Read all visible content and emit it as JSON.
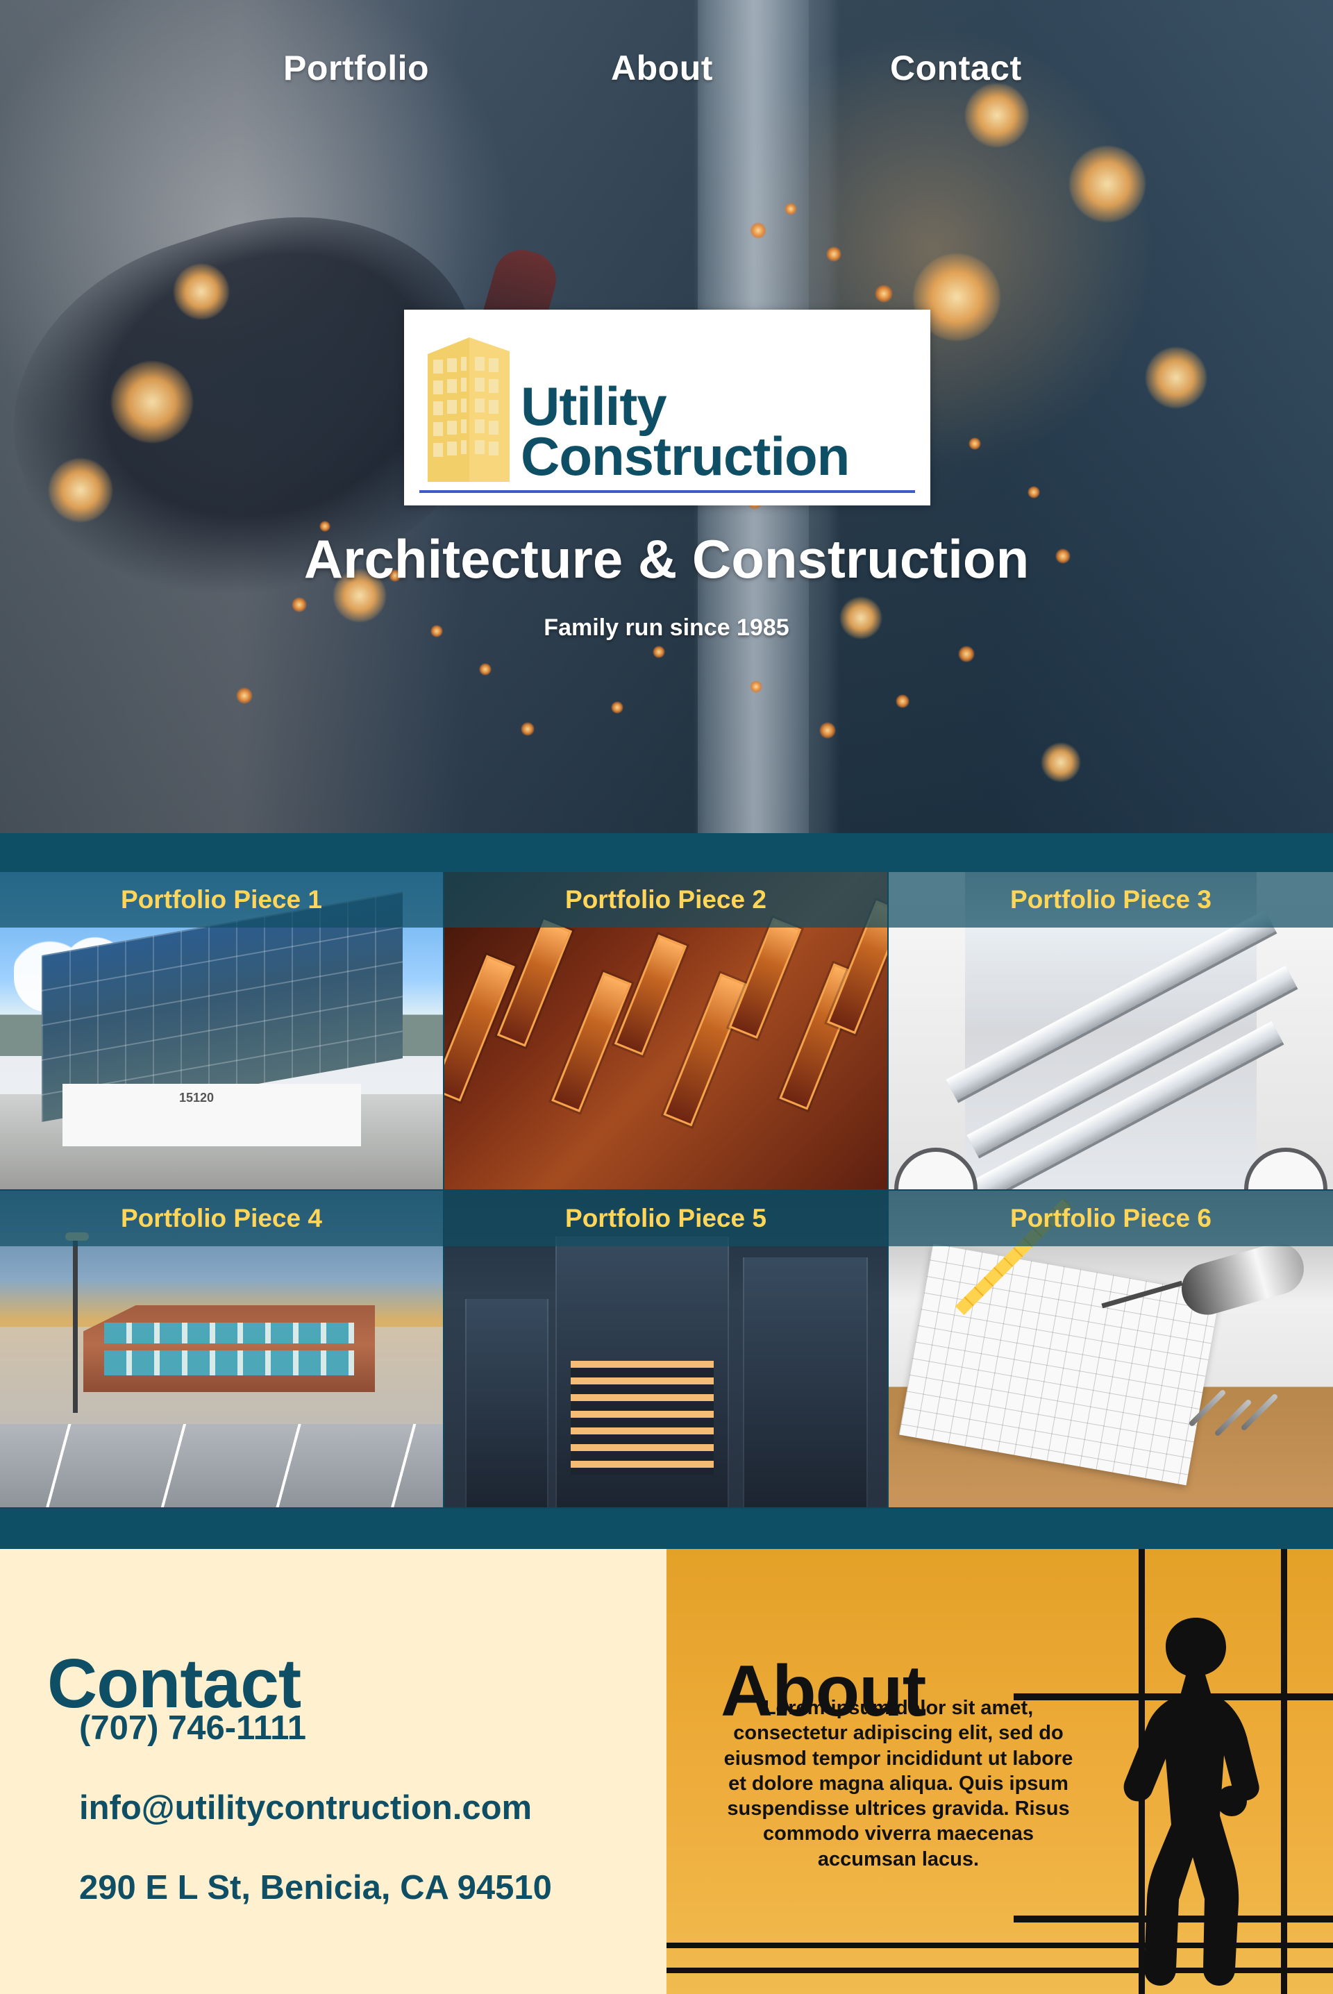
{
  "nav": {
    "portfolio": "Portfolio",
    "about": "About",
    "contact": "Contact"
  },
  "hero": {
    "logo_line1": "Utility",
    "logo_line2": "Construction",
    "title": "Architecture & Construction",
    "tagline": "Family run since 1985"
  },
  "portfolio": {
    "items": [
      {
        "label": "Portfolio Piece 1"
      },
      {
        "label": "Portfolio Piece 2"
      },
      {
        "label": "Portfolio Piece 3"
      },
      {
        "label": "Portfolio Piece 4"
      },
      {
        "label": "Portfolio Piece 5"
      },
      {
        "label": "Portfolio Piece 6"
      }
    ]
  },
  "contact": {
    "title": "Contact",
    "phone": "(707) 746-1111",
    "email": "info@utilitycontruction.com",
    "address": "290 E L St, Benicia, CA 94510"
  },
  "about": {
    "title": "About",
    "body": "Lorem ipsum dolor sit amet, consectetur adipiscing elit, sed do eiusmod tempor incididunt ut labore et dolore magna aliqua. Quis ipsum suspendisse ultrices gravida. Risus commodo viverra maecenas accumsan lacus."
  },
  "colors": {
    "teal": "#0f4f66",
    "gold": "#ffd65a",
    "contact_bg": "#fff0cf",
    "about_bg": "#e4a128"
  },
  "icons": {
    "logo": "building-logo-icon"
  }
}
